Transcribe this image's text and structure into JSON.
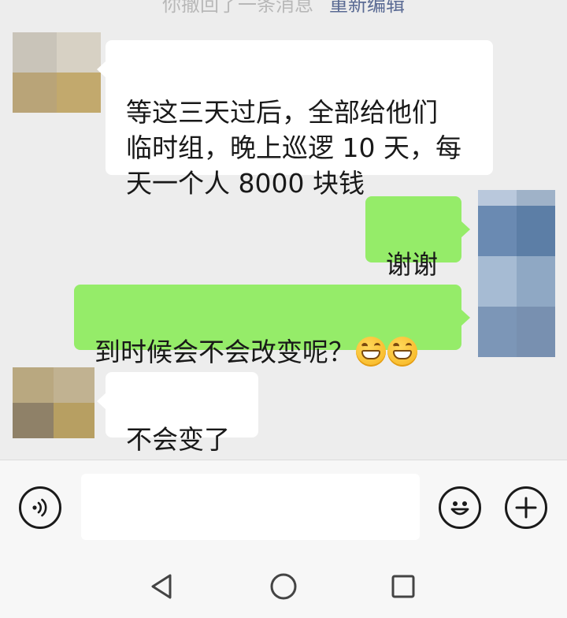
{
  "colors": {
    "chat_background": "#ededed",
    "bubble_incoming": "#ffffff",
    "bubble_outgoing": "#95ec69",
    "link": "#5b6b94",
    "notice_text": "#b8b8b8"
  },
  "notice": {
    "text": "你撤回了一条消息",
    "link": "重新编辑"
  },
  "messages": [
    {
      "direction": "incoming",
      "text": "等这三天过后，全部给他们\n临时组，晚上巡逻 10 天，每\n天一个人 8000 块钱"
    },
    {
      "direction": "outgoing",
      "text": "谢谢"
    },
    {
      "direction": "outgoing",
      "text": "到时候会不会改变呢？",
      "emojis": [
        "grinning-face-icon",
        "grinning-face-icon"
      ]
    },
    {
      "direction": "incoming",
      "text": "不会变了"
    }
  ],
  "input_bar": {
    "voice_icon": "voice-input-icon",
    "text_value": "",
    "emoji_icon": "smiley-face-icon",
    "plus_icon": "plus-circle-icon"
  },
  "navigation": {
    "back_icon": "triangle-back-icon",
    "home_icon": "circle-home-icon",
    "recents_icon": "square-recents-icon"
  }
}
